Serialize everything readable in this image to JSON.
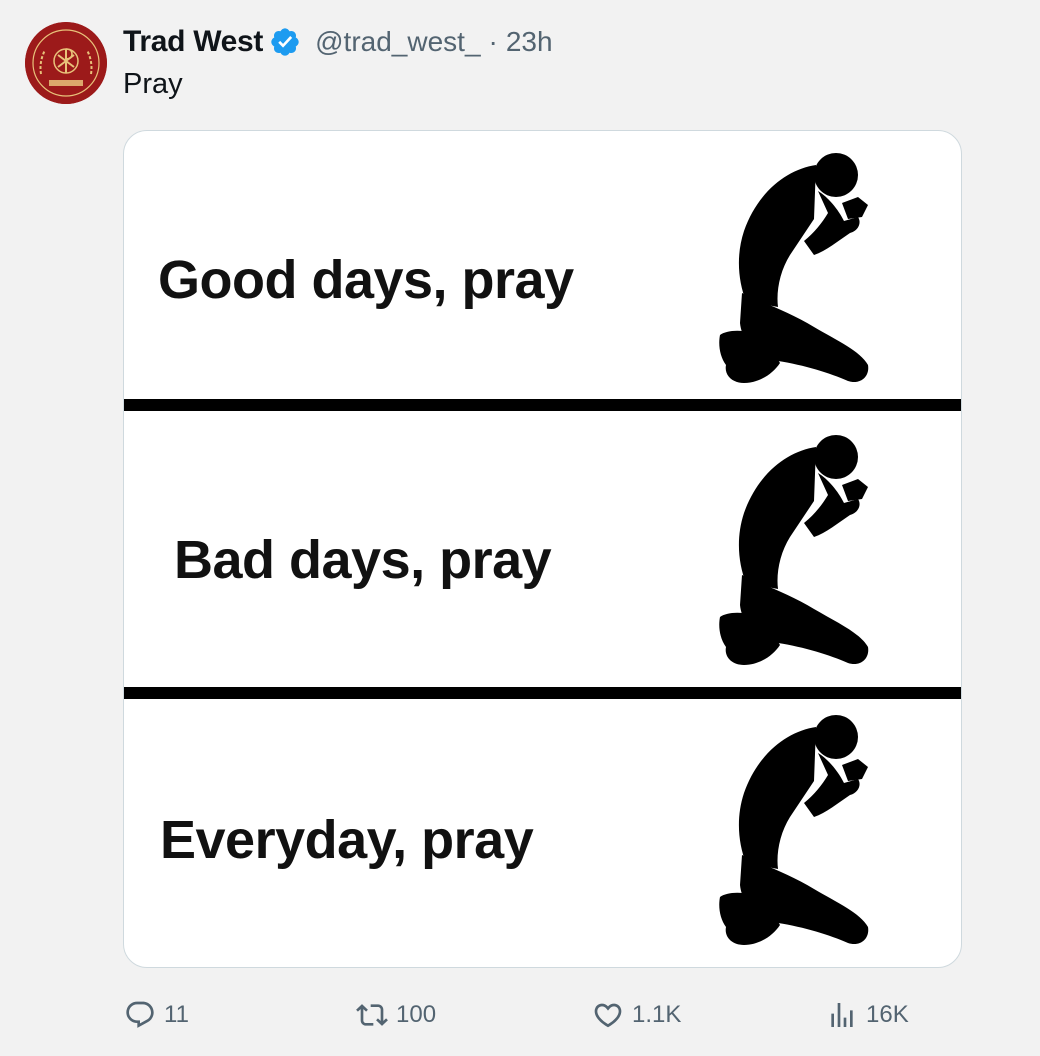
{
  "author": {
    "name": "Trad West",
    "handle": "@trad_west_",
    "separator": "·",
    "time": "23h",
    "avatar_icon": "trad-west-crest-logo",
    "verified_icon": "verified-badge-icon",
    "avatar_lettering": [
      "TRAD WEST",
      "IN HOC SIGNO VINCES"
    ]
  },
  "tweet": {
    "text": "Pray"
  },
  "media": {
    "panels": [
      {
        "text": "Good days, pray",
        "icon": "kneeling-praying-figure"
      },
      {
        "text": "Bad days, pray",
        "icon": "kneeling-praying-figure"
      },
      {
        "text": "Everyday, pray",
        "icon": "kneeling-praying-figure"
      }
    ]
  },
  "actions": {
    "reply": {
      "icon": "reply-icon",
      "count": "11"
    },
    "retweet": {
      "icon": "retweet-icon",
      "count": "100"
    },
    "like": {
      "icon": "heart-icon",
      "count": "1.1K"
    },
    "views": {
      "icon": "views-chart-icon",
      "count": "16K"
    }
  },
  "colors": {
    "background": "#f2f2f2",
    "text_primary": "#0f1419",
    "text_secondary": "#536471",
    "verified_blue": "#1d9bf0",
    "avatar_red": "#9c1a1a",
    "card_border": "#cfd9de"
  }
}
